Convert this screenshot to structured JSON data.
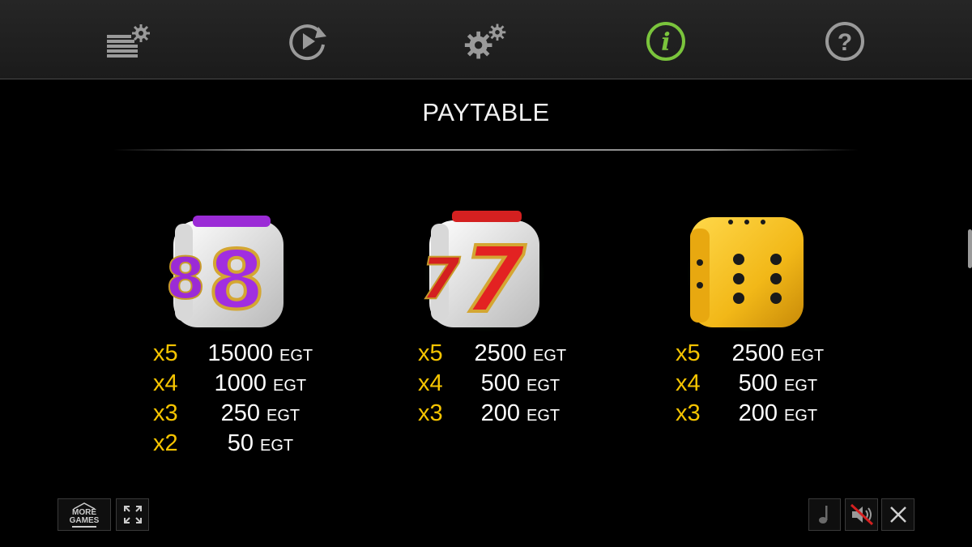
{
  "topbar": {
    "buttons": [
      {
        "name": "bet-settings-icon"
      },
      {
        "name": "autoplay-icon"
      },
      {
        "name": "settings-icon"
      },
      {
        "name": "info-icon",
        "active": true
      },
      {
        "name": "help-icon"
      }
    ],
    "active_color": "#7ac43c",
    "icon_color": "#9a9a9a"
  },
  "paytable": {
    "title": "PAYTABLE",
    "symbols": [
      {
        "name": "purple-eight-dice",
        "rows": [
          {
            "mult": "x5",
            "amount": "15000",
            "currency": "EGT"
          },
          {
            "mult": "x4",
            "amount": "1000",
            "currency": "EGT"
          },
          {
            "mult": "x3",
            "amount": "250",
            "currency": "EGT"
          },
          {
            "mult": "x2",
            "amount": "50",
            "currency": "EGT"
          }
        ]
      },
      {
        "name": "red-seven-dice",
        "rows": [
          {
            "mult": "x5",
            "amount": "2500",
            "currency": "EGT"
          },
          {
            "mult": "x4",
            "amount": "500",
            "currency": "EGT"
          },
          {
            "mult": "x3",
            "amount": "200",
            "currency": "EGT"
          }
        ]
      },
      {
        "name": "golden-dice",
        "rows": [
          {
            "mult": "x5",
            "amount": "2500",
            "currency": "EGT"
          },
          {
            "mult": "x4",
            "amount": "500",
            "currency": "EGT"
          },
          {
            "mult": "x3",
            "amount": "200",
            "currency": "EGT"
          }
        ]
      }
    ],
    "multiplier_color": "#f5c400"
  },
  "bottom": {
    "more_games_line1": "MORE",
    "more_games_line2": "GAMES"
  }
}
